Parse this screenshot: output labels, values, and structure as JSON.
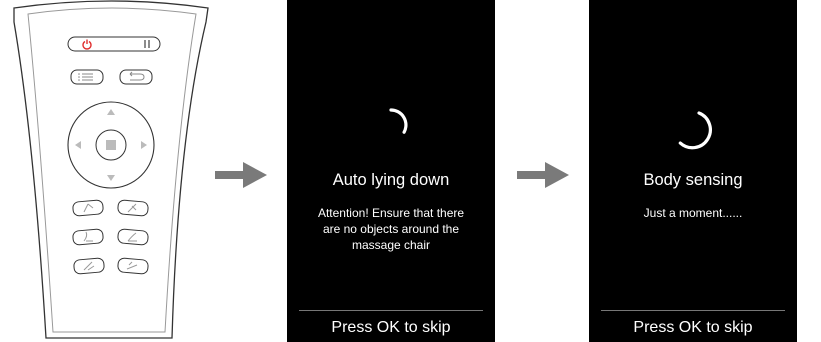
{
  "colors": {
    "background": "#ffffff",
    "screen_bg": "#000000",
    "screen_text": "#ffffff",
    "divider": "#777777",
    "arrow": "#7a7a7a",
    "remote_outline": "#333333",
    "remote_button": "#bbbbbb",
    "power_accent": "#e03030"
  },
  "remote": {
    "icons": {
      "power": "power-icon",
      "pause": "pause-icon",
      "menu": "menu-list-icon",
      "back": "back-icon",
      "up": "arrow-up-icon",
      "down": "arrow-down-icon",
      "left": "arrow-left-icon",
      "right": "arrow-right-icon",
      "ok": "ok-stop-icon",
      "recline": "recline-icon",
      "leg": "leg-rest-icon",
      "backrest": "backrest-icon"
    }
  },
  "screens": [
    {
      "title": "Auto lying down",
      "message": [
        "Attention! Ensure that there",
        "are no objects around the",
        "massage chair"
      ],
      "footer": "Press OK to skip",
      "spinner_icon": "loading-spinner-icon",
      "spinner_progress": 0.25
    },
    {
      "title": "Body sensing",
      "message": [
        "Just a moment......"
      ],
      "footer": "Press OK to skip",
      "spinner_icon": "loading-spinner-icon",
      "spinner_progress": 0.7
    }
  ]
}
